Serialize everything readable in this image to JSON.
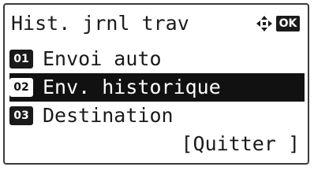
{
  "header": {
    "title": "Hist. jrnl trav",
    "nav_icon": "four-way-arrow-icon",
    "ok_label": "OK"
  },
  "menu": {
    "items": [
      {
        "number": "01",
        "label": "Envoi auto",
        "selected": false
      },
      {
        "number": "02",
        "label": "Env. historique",
        "selected": true
      },
      {
        "number": "03",
        "label": "Destination",
        "selected": false
      }
    ]
  },
  "footer": {
    "quit_label": "[Quitter ]"
  },
  "colors": {
    "text": "#1a1a1a",
    "highlight_bg": "#111111",
    "highlight_text": "#ffffff",
    "background": "#ffffff"
  }
}
